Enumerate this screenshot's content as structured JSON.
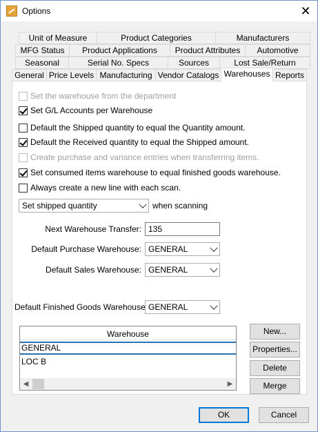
{
  "window": {
    "title": "Options"
  },
  "tabs": {
    "row1": [
      "Unit of Measure",
      "Product Categories",
      "Manufacturers"
    ],
    "row2": [
      "MFG Status",
      "Product Applications",
      "Product Attributes",
      "Automotive"
    ],
    "row3": [
      "Seasonal",
      "Serial No. Specs",
      "Sources",
      "Lost Sale/Return"
    ],
    "row4": [
      "General",
      "Price Levels",
      "Manufacturing",
      "Vendor Catalogs",
      "Warehouses",
      "Reports"
    ],
    "active": "Warehouses"
  },
  "options": [
    {
      "label": "Set the warehouse from the department",
      "checked": false,
      "enabled": false
    },
    {
      "label": "Set G/L Accounts per Warehouse",
      "checked": true,
      "enabled": true
    },
    {
      "label": "Default the Shipped quantity to equal the Quantity amount.",
      "checked": false,
      "enabled": true
    },
    {
      "label": "Default the Received quantity to equal the Shipped amount.",
      "checked": true,
      "enabled": true
    },
    {
      "label": "Create purchase and variance entries when transferring items.",
      "checked": false,
      "enabled": false
    },
    {
      "label": "Set consumed items warehouse to equal finished goods warehouse.",
      "checked": true,
      "enabled": true
    },
    {
      "label": "Always create a new line with each scan.",
      "checked": false,
      "enabled": true
    }
  ],
  "scan": {
    "value": "Set shipped quantity",
    "suffix": "when scanning"
  },
  "fields": {
    "next_transfer_label": "Next Warehouse Transfer:",
    "next_transfer_value": "135",
    "purchase_label": "Default Purchase Warehouse:",
    "purchase_value": "GENERAL",
    "sales_label": "Default Sales Warehouse:",
    "sales_value": "GENERAL",
    "finished_label": "Default Finished Goods Warehouse:",
    "finished_value": "GENERAL"
  },
  "grid": {
    "header": "Warehouse",
    "rows": [
      "GENERAL",
      "LOC B"
    ]
  },
  "side_buttons": {
    "new": "New...",
    "properties": "Properties...",
    "delete": "Delete",
    "merge": "Merge"
  },
  "footer": {
    "ok": "OK",
    "cancel": "Cancel"
  }
}
